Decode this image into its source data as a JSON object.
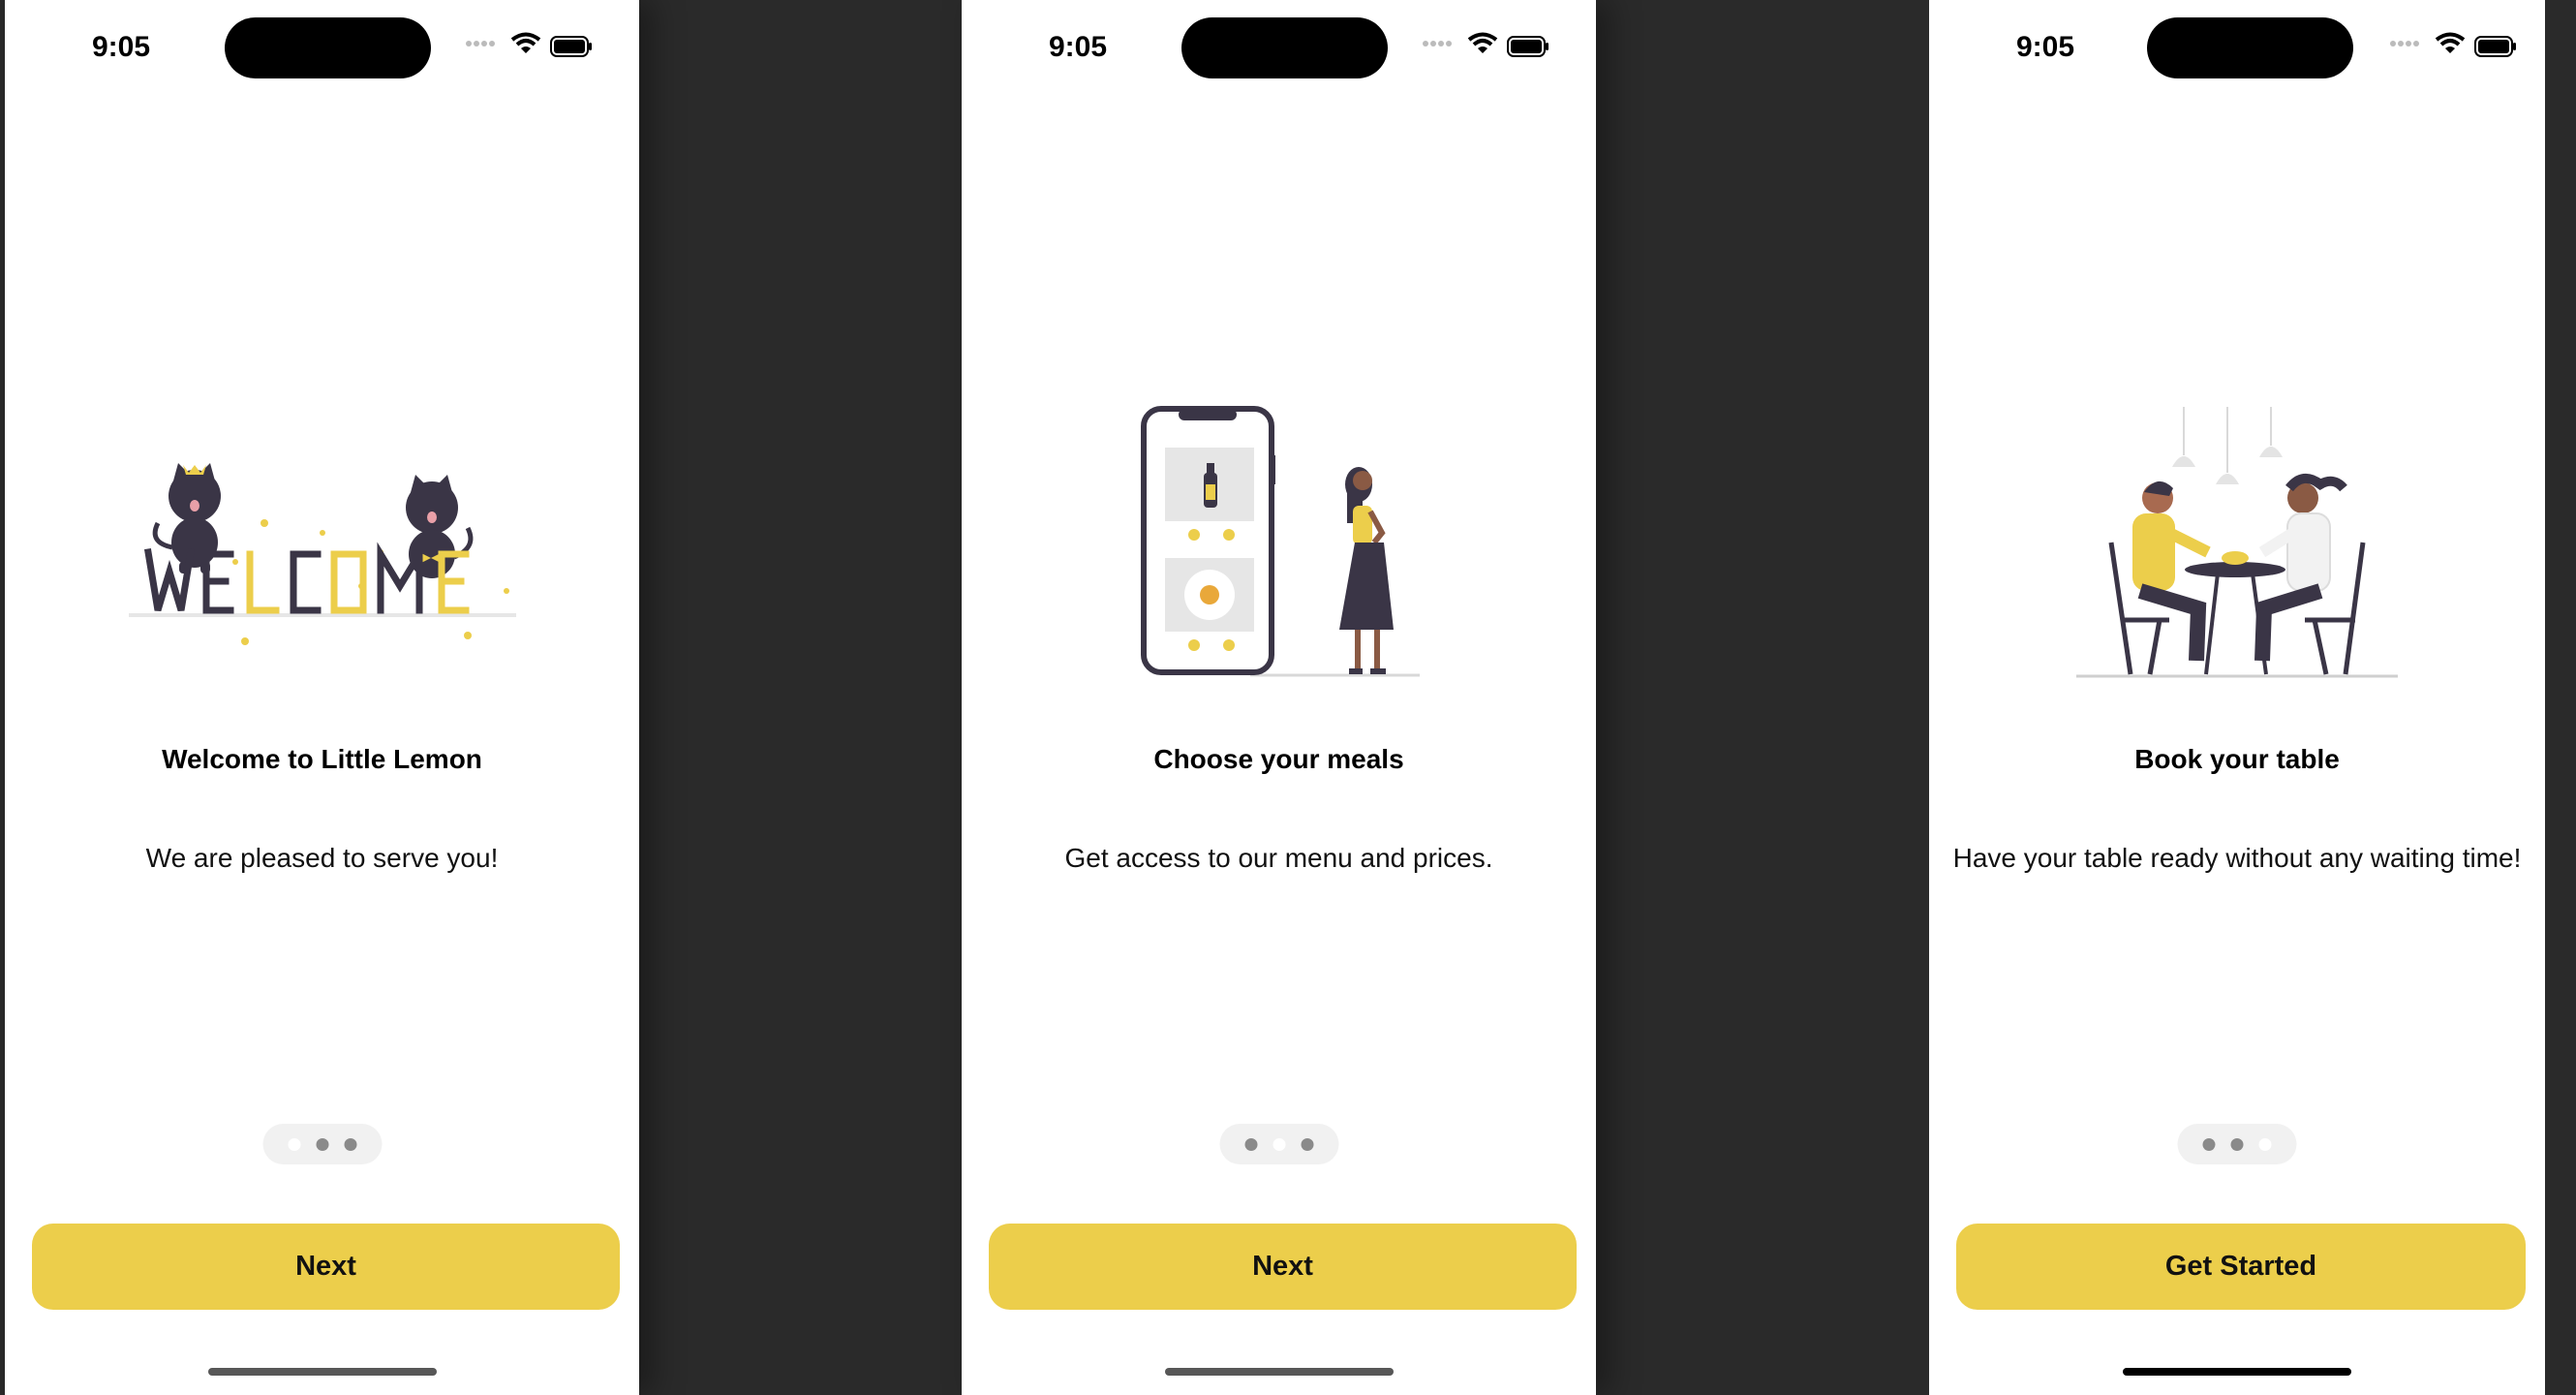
{
  "status": {
    "time": "9:05"
  },
  "screens": [
    {
      "title": "Welcome to Little Lemon",
      "subtitle": "We are pleased to serve you!",
      "button": "Next",
      "illustration": "welcome-cats",
      "illustration_text": "WELCOME",
      "page_indicator": {
        "count": 3,
        "active": 1
      }
    },
    {
      "title": "Choose your meals",
      "subtitle": "Get access to our menu and prices.",
      "button": "Next",
      "illustration": "phone-menu-woman",
      "page_indicator": {
        "count": 3,
        "active": 2
      }
    },
    {
      "title": "Book your table",
      "subtitle": "Have your table ready without any waiting time!",
      "button": "Get Started",
      "illustration": "couple-dining",
      "page_indicator": {
        "count": 3,
        "active": 3
      }
    }
  ],
  "colors": {
    "accent": "#ecce4b",
    "ink": "#3a3546",
    "background": "#2a2a2a"
  }
}
